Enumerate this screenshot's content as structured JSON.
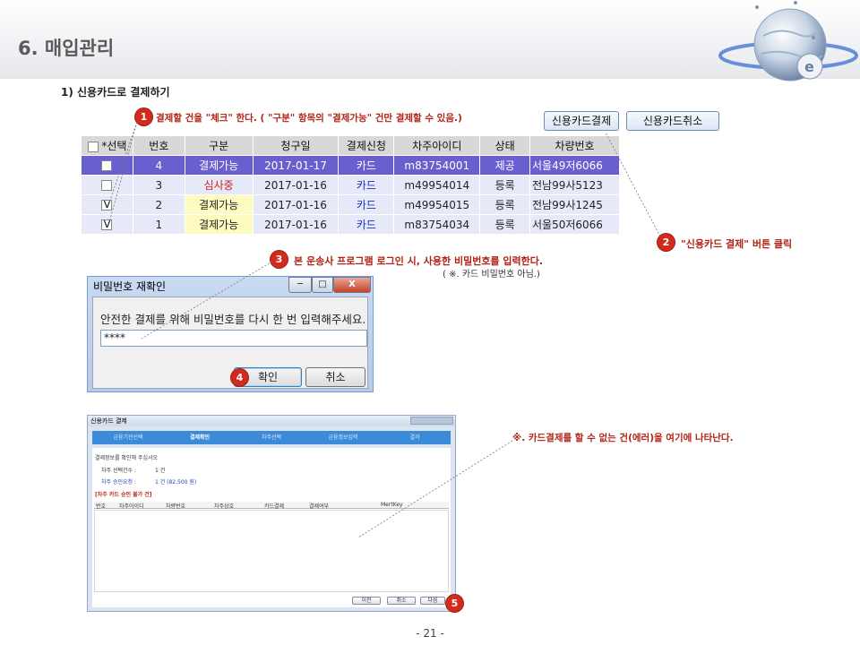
{
  "page": {
    "title": "6. 매입관리",
    "subtitle": "1) 신용카드로 결제하기",
    "page_number": "- 21 -"
  },
  "toolbar": {
    "pay_button": "신용카드결제",
    "cancel_button": "신용카드취소"
  },
  "steps": [
    {
      "num": "1",
      "text": "결제할 건을 \"체크\" 한다. ( \"구분\" 항목의 \"결제가능\" 건만 결제할 수 있음.)"
    },
    {
      "num": "2",
      "text": "\"신용카드 결제\" 버튼 클릭"
    },
    {
      "num": "3",
      "text": "본 운송사 프로그램 로그인 시, 사용한 비밀번호를 입력한다.",
      "sub": "( ※. 카드 비밀번호 아님.)"
    },
    {
      "num": "4"
    },
    {
      "num": "5"
    }
  ],
  "error_note": "※.  카드결제를 할 수 없는 건(에러)을 여기에 나타난다.",
  "grid": {
    "headers": [
      "선택",
      "번호",
      "구분",
      "청구일",
      "결제신청",
      "차주아이디",
      "상태",
      "차량번호"
    ],
    "header_check_mark": "*",
    "rows": [
      {
        "check": "",
        "no": "4",
        "type": "결제가능",
        "date": "2017-01-17",
        "pay": "카드",
        "id": "m83754001",
        "status": "제공",
        "car": "서울49저6066"
      },
      {
        "check": "",
        "no": "3",
        "type": "심사중",
        "date": "2017-01-16",
        "pay": "카드",
        "id": "m49954014",
        "status": "등록",
        "car": "전남99사5123"
      },
      {
        "check": "V",
        "no": "2",
        "type": "결제가능",
        "date": "2017-01-16",
        "pay": "카드",
        "id": "m49954015",
        "status": "등록",
        "car": "전남99사1245"
      },
      {
        "check": "V",
        "no": "1",
        "type": "결제가능",
        "date": "2017-01-16",
        "pay": "카드",
        "id": "m83754034",
        "status": "등록",
        "car": "서울50저6066"
      }
    ]
  },
  "password_dialog": {
    "title": "비밀번호 재확인",
    "message": "안전한 결제를 위해 비밀번호를 다시 한 번 입력해주세요.",
    "value": "****",
    "ok": "확인",
    "cancel": "취소",
    "min": "─",
    "max": "□",
    "close": "X"
  },
  "card_dialog": {
    "title": "신용카드 결제",
    "steps": [
      "금융기관선택",
      "결제확인",
      "차주선택",
      "금융정보입력",
      "결과"
    ],
    "active_step": 1,
    "prompt": "결제정보를 확인해 주십시오",
    "count_label": "차주 선택건수 :",
    "count_value": "1 건",
    "amount_label": "차주 승인요청 :",
    "amount_value": "1 건   (82,500 원)",
    "error_title": "[차주 카드 승인 불가 건]",
    "columns": [
      "번호",
      "차주아이디",
      "차량번호",
      "차주상호",
      "카드결제",
      "결제여부",
      "MertKey"
    ],
    "buttons": [
      "이전",
      "취소",
      "다음"
    ]
  }
}
